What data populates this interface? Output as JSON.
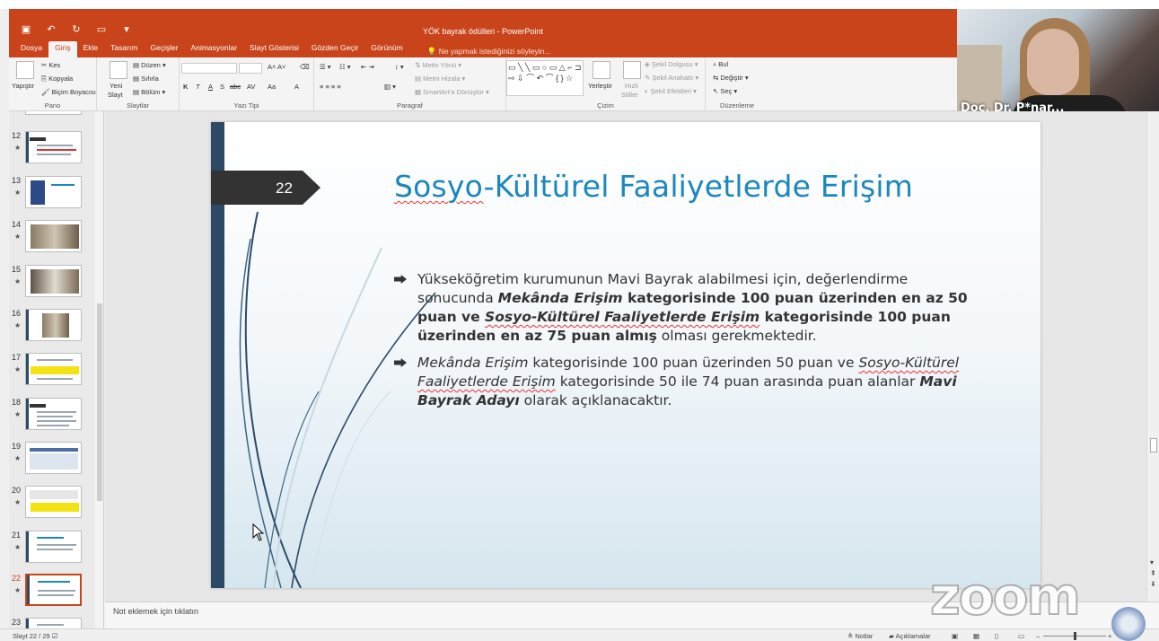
{
  "window": {
    "title": "YÖK bayrak ödülleri - PowerPoint",
    "accent_color": "#c9441a"
  },
  "quick_access": {
    "icons": [
      "save-icon",
      "undo-icon",
      "redo-icon",
      "start-from-beginning-icon",
      "customize-icon"
    ]
  },
  "ribbon_tabs": [
    {
      "label": "Dosya"
    },
    {
      "label": "Giriş",
      "active": true
    },
    {
      "label": "Ekle"
    },
    {
      "label": "Tasarım"
    },
    {
      "label": "Geçişler"
    },
    {
      "label": "Animasyonlar"
    },
    {
      "label": "Slayt Gösterisi"
    },
    {
      "label": "Gözden Geçir"
    },
    {
      "label": "Görünüm"
    }
  ],
  "tell_me": "Ne yapmak istediğinizi söyleyin...",
  "ribbon": {
    "pano": {
      "label": "Pano",
      "paste": "Yapıştır",
      "cut": "Kes",
      "copy": "Kopyala",
      "format_painter": "Biçim Boyacısı"
    },
    "slaytlar": {
      "label": "Slaytlar",
      "new_slide_1": "Yeni",
      "new_slide_2": "Slayt",
      "layout": "Düzen",
      "reset": "Sıfırla",
      "section": "Bölüm"
    },
    "yazi_tipi": {
      "label": "Yazı Tipi",
      "bold": "K",
      "italic": "T",
      "underline": "A",
      "shadow": "S",
      "strike": "abc",
      "spacing": "AV",
      "case": "Aa",
      "color": "A"
    },
    "paragraf": {
      "label": "Paragraf",
      "text_direction": "Metin Yönü",
      "align_text": "Metni Hizala",
      "smartart": "SmartArt'a Dönüştür"
    },
    "cizim": {
      "label": "Çizim",
      "arrange": "Yerleştir",
      "quick_styles_1": "Hızlı",
      "quick_styles_2": "Stiller",
      "shape_fill": "Şekil Dolgusu",
      "shape_outline": "Şekil Anahattı",
      "shape_effects": "Şekil Efektleri"
    },
    "duzenleme": {
      "label": "Düzenleme",
      "find": "Bul",
      "replace": "Değiştir",
      "select": "Seç"
    }
  },
  "participant": {
    "name": "Doç. Dr. P*nar..."
  },
  "thumbnails": [
    {
      "num": "12",
      "kind": "text"
    },
    {
      "num": "13",
      "kind": "photo-text"
    },
    {
      "num": "14",
      "kind": "photo"
    },
    {
      "num": "15",
      "kind": "photo"
    },
    {
      "num": "16",
      "kind": "photo-small"
    },
    {
      "num": "17",
      "kind": "yellow"
    },
    {
      "num": "18",
      "kind": "text"
    },
    {
      "num": "19",
      "kind": "table"
    },
    {
      "num": "20",
      "kind": "yellow-table"
    },
    {
      "num": "21",
      "kind": "text"
    },
    {
      "num": "22",
      "kind": "text",
      "active": true
    },
    {
      "num": "23",
      "kind": "text"
    }
  ],
  "slide": {
    "number": "22",
    "title_part1": "Sosyo",
    "title_part2": "-Kültürel Faaliyetlerde Erişim",
    "bullet1": {
      "t1": "Yükseköğretim kurumunun Mavi Bayrak alabilmesi için, değerlendirme sonucunda ",
      "t2": "Mekânda Erişim",
      "t3": " kategorisinde 100 puan üzerinden en az 50 puan ve ",
      "t4": "Sosyo-Kültürel Faaliyetlerde Erişim",
      "t5": " kategorisinde 100 puan üzerinden en az 75 puan almış",
      "t6": " olması gerekmektedir."
    },
    "bullet2": {
      "t1": "Mekânda Erişim",
      "t2": " kategorisinde 100 puan üzerinden 50 puan ve ",
      "t3": "Sosyo-Kültürel Faaliyetlerde Erişim",
      "t4": " kategorisinde 50 ile 74 puan arasında puan alanlar ",
      "t5": "Mavi Bayrak Adayı",
      "t6": " olarak açıklanacaktır."
    }
  },
  "notes": {
    "placeholder": "Not eklemek için tıklatın"
  },
  "status": {
    "slide_indicator": "Slayt 22 / 29",
    "notes_btn": "Notlar",
    "comments_btn": "Açıklamalar"
  },
  "overlay": {
    "zoom_logo": "zoom"
  }
}
